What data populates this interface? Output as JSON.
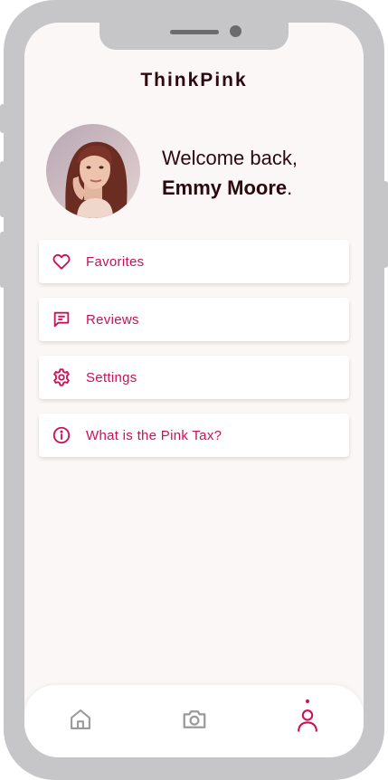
{
  "app": {
    "title": "ThinkPink"
  },
  "profile": {
    "greeting": "Welcome back,",
    "name": "Emmy Moore",
    "name_suffix": "."
  },
  "menu": {
    "items": [
      {
        "label": "Favorites",
        "icon": "heart-icon"
      },
      {
        "label": "Reviews",
        "icon": "message-icon"
      },
      {
        "label": "Settings",
        "icon": "gear-icon"
      },
      {
        "label": "What is the Pink Tax?",
        "icon": "info-icon"
      }
    ]
  },
  "tabbar": {
    "tabs": [
      {
        "icon": "home-icon",
        "active": false
      },
      {
        "icon": "camera-icon",
        "active": false
      },
      {
        "icon": "user-icon",
        "active": true
      }
    ]
  },
  "colors": {
    "accent": "#cc1057",
    "text_dark": "#2b0a0f",
    "background": "#fcf7f7",
    "frame": "#c6c6c8",
    "inactive_icon": "#9a9a9a"
  }
}
